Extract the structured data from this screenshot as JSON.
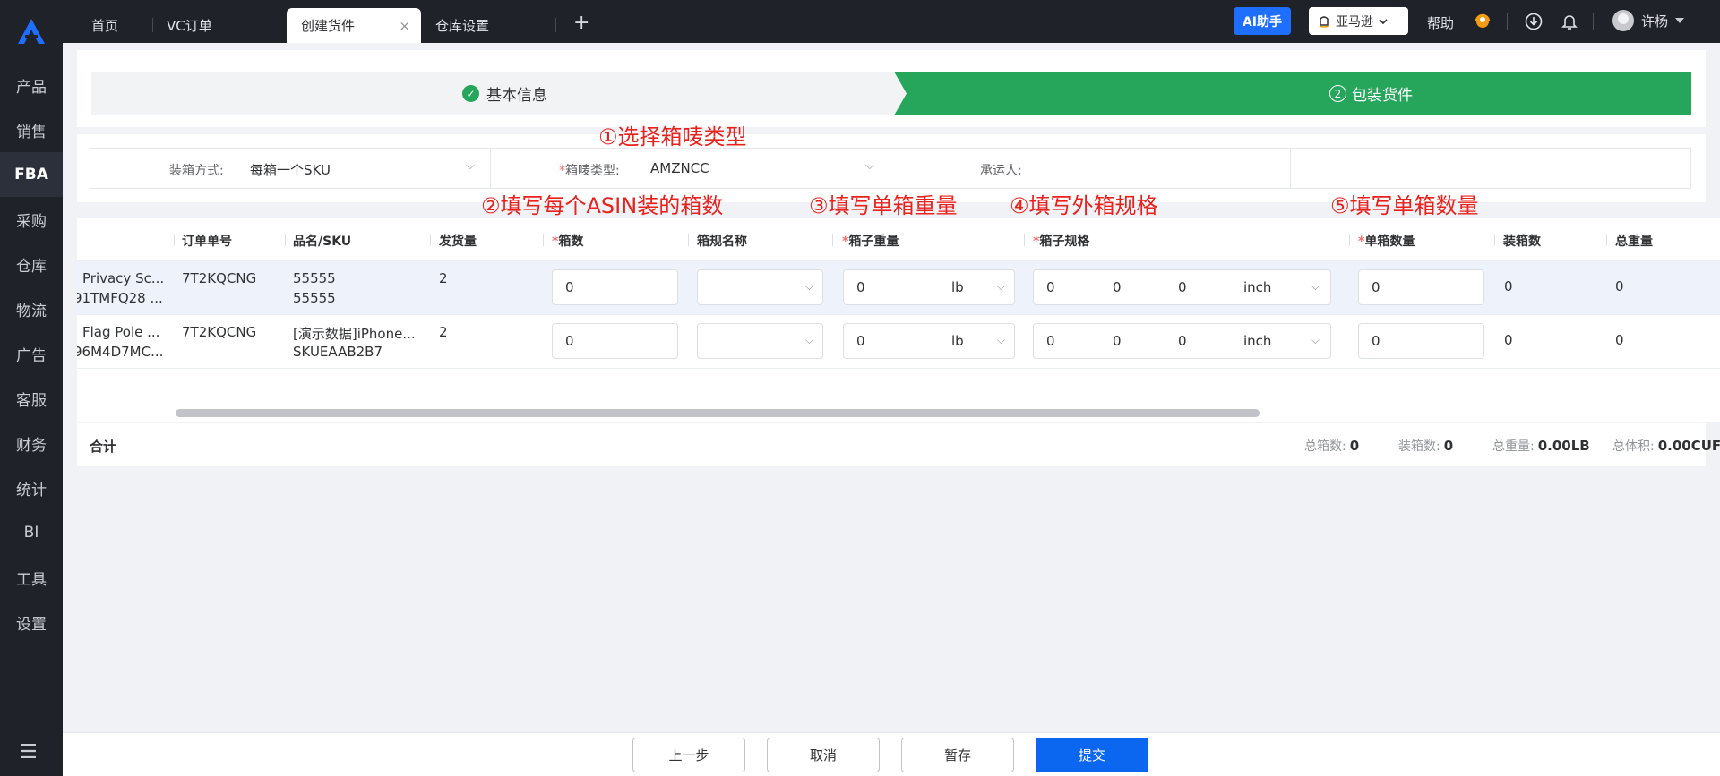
{
  "sidebar": {
    "items": [
      {
        "label": "产品"
      },
      {
        "label": "销售"
      },
      {
        "label": "FBA"
      },
      {
        "label": "采购"
      },
      {
        "label": "仓库"
      },
      {
        "label": "物流"
      },
      {
        "label": "广告"
      },
      {
        "label": "客服"
      },
      {
        "label": "财务"
      },
      {
        "label": "统计"
      },
      {
        "label": "BI"
      },
      {
        "label": "工具"
      },
      {
        "label": "设置"
      }
    ],
    "active": "FBA",
    "menu_icon": "☰"
  },
  "topbar": {
    "tabs": [
      {
        "label": "首页"
      },
      {
        "label": "VC订单"
      },
      {
        "label": "创建货件",
        "active": true,
        "close": "×"
      },
      {
        "label": "仓库设置"
      }
    ],
    "add_tab": "+",
    "ai_button": "AI助手",
    "store_select": "亚马逊",
    "help": "帮助",
    "user": "许杨"
  },
  "steps": {
    "step1": "基本信息",
    "step2_num": "2",
    "step2": "包装货件",
    "colors": {
      "done": "#26a65b"
    }
  },
  "form": {
    "packing_label": "装箱方式:",
    "packing_value": "每箱一个SKU",
    "mark_required": "*",
    "mark_label": "箱唛类型:",
    "mark_value": "AMZNCC",
    "carrier_label": "承运人:"
  },
  "annotations": {
    "a1": "①选择箱唛类型",
    "a2": "②填写每个ASIN装的箱数",
    "a3": "③填写单箱重量",
    "a4": "④填写外箱规格",
    "a5": "⑤填写单箱数量"
  },
  "table": {
    "headers": {
      "order_no": "订单单号",
      "name_sku": "品名/SKU",
      "ship_qty": "发货量",
      "box_count": "箱数",
      "box_spec_name": "箱规名称",
      "box_weight": "箱子重量",
      "box_dims": "箱子规格",
      "per_box_qty": "单箱数量",
      "packed_boxes": "装箱数",
      "total_weight": "总重量",
      "required_mark": "*"
    },
    "rows": [
      {
        "product_line1": "Privacy Sc...",
        "product_line2": "91TMFQ28 ...",
        "order_no": "7T2KQCNG",
        "name": "55555",
        "sku": "55555",
        "ship_qty": "2",
        "box_count": "0",
        "weight": "0",
        "weight_unit": "lb",
        "dim_l": "0",
        "dim_w": "0",
        "dim_h": "0",
        "dim_unit": "inch",
        "per_box_qty": "0",
        "packed_boxes": "0",
        "total_weight": "0"
      },
      {
        "product_line1": "Flag Pole ...",
        "product_line2": "96M4D7MC...",
        "order_no": "7T2KQCNG",
        "name": "[演示数据]iPhone...",
        "sku": "SKUEAAB2B7",
        "ship_qty": "2",
        "box_count": "0",
        "weight": "0",
        "weight_unit": "lb",
        "dim_l": "0",
        "dim_w": "0",
        "dim_h": "0",
        "dim_unit": "inch",
        "per_box_qty": "0",
        "packed_boxes": "0",
        "total_weight": "0"
      }
    ]
  },
  "summary": {
    "label": "合计",
    "total_boxes_label": "总箱数:",
    "total_boxes": "0",
    "packed_label": "装箱数:",
    "packed": "0",
    "weight_label": "总重量:",
    "weight": "0.00LB",
    "volume_label": "总体积:",
    "volume": "0.00CUFT"
  },
  "footer": {
    "prev": "上一步",
    "cancel": "取消",
    "save": "暂存",
    "submit": "提交",
    "colors": {
      "primary": "#0b66f0"
    }
  }
}
